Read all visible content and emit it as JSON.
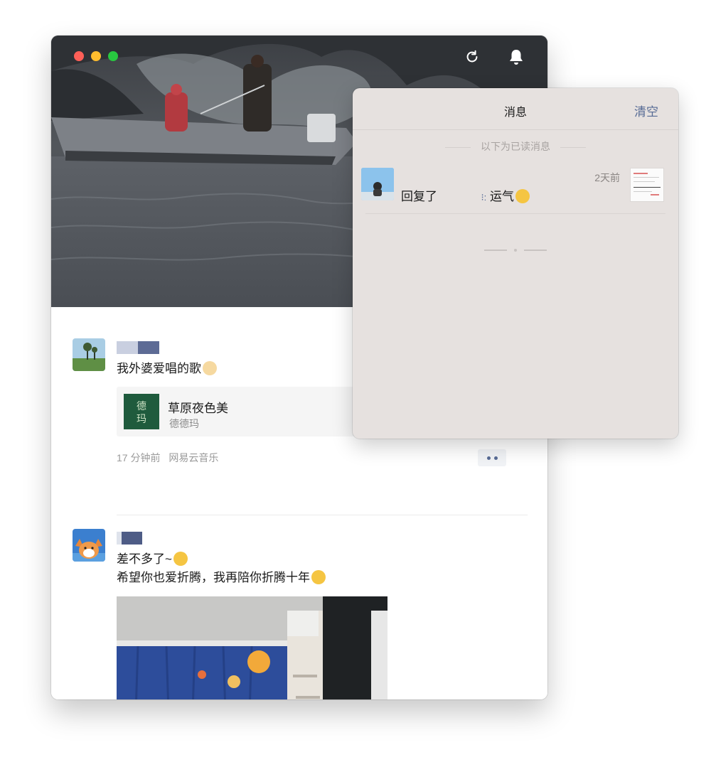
{
  "popover": {
    "title": "消息",
    "clear_label": "清空",
    "read_divider": "以下为已读消息",
    "notifications": [
      {
        "prefix": "回复了",
        "suffix": "运气",
        "time": "2天前"
      }
    ]
  },
  "feed": {
    "posts": [
      {
        "text": "我外婆爱唱的歌",
        "music": {
          "title": "草原夜色美",
          "artist": "德德玛"
        },
        "time": "17 分钟前",
        "source": "网易云音乐"
      },
      {
        "line1": "差不多了~",
        "line2": "希望你也爱折腾，我再陪你折腾十年"
      }
    ]
  }
}
